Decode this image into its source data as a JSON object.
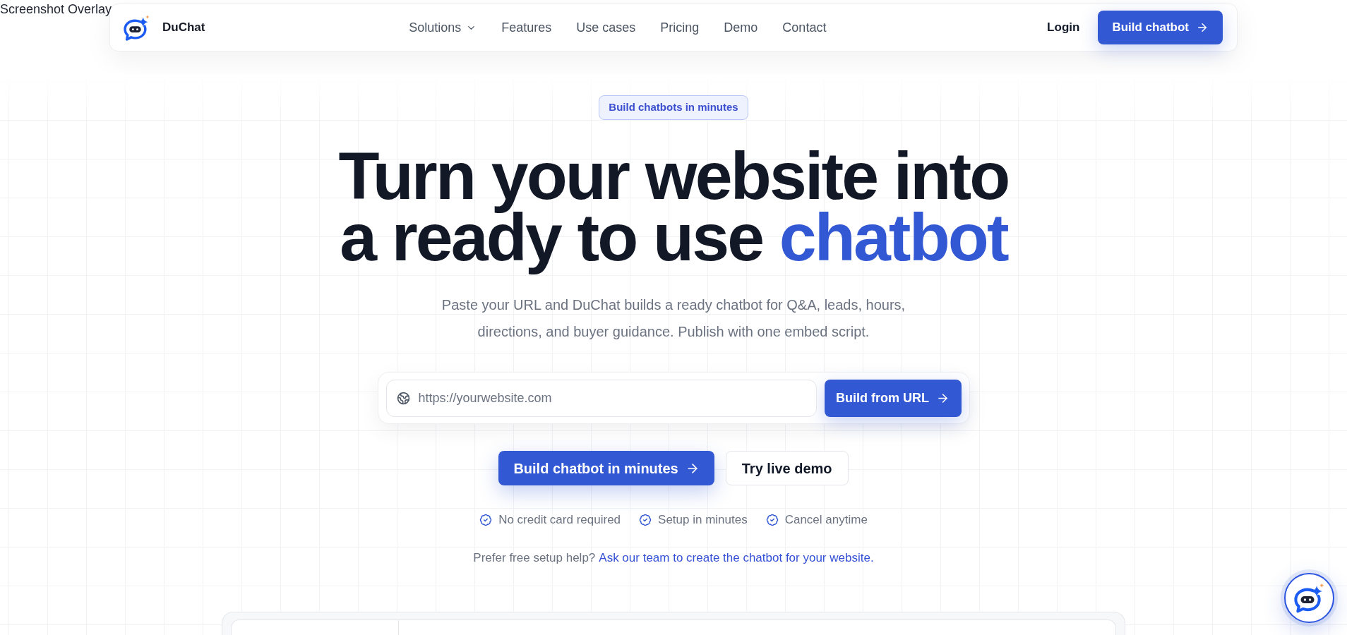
{
  "overlay_label": "Screenshot Overlay",
  "navbar": {
    "brand": "DuChat",
    "links": [
      {
        "label": "Solutions",
        "kind": "dropdown"
      },
      {
        "label": "Features",
        "kind": "link"
      },
      {
        "label": "Use cases",
        "kind": "link"
      },
      {
        "label": "Pricing",
        "kind": "link"
      },
      {
        "label": "Demo",
        "kind": "link"
      },
      {
        "label": "Contact",
        "kind": "link"
      }
    ],
    "login": "Login",
    "cta": "Build chatbot"
  },
  "hero": {
    "badge": "Build chatbots in minutes",
    "headline": {
      "line_1": "Turn your website into",
      "line_2": "a ready to use",
      "highlight": "chatbot"
    },
    "subtitle": "Paste your URL and DuChat builds a ready chatbot for Q&A, leads, hours, directions, and buyer guidance. Publish with one embed script."
  },
  "url_form": {
    "placeholder": "https://yourwebsite.com",
    "button": "Build from URL"
  },
  "actions": [
    {
      "label": "Build chatbot in minutes",
      "kind": "primary"
    },
    {
      "label": "Try live demo",
      "kind": "secondary"
    }
  ],
  "perks": [
    "No credit card required",
    "Setup in minutes",
    "Cancel anytime"
  ],
  "help": {
    "text": "Prefer free setup help?",
    "link": "Ask our team to create the chatbot for your website."
  }
}
